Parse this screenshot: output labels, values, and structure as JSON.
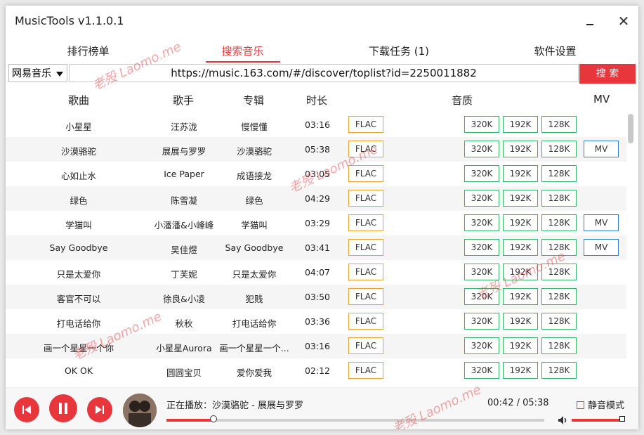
{
  "app": {
    "title": "MusicTools v1.1.0.1"
  },
  "tabs": [
    {
      "label": "排行榜单"
    },
    {
      "label": "搜索音乐"
    },
    {
      "label": "下载任务 (1)"
    },
    {
      "label": "软件设置"
    }
  ],
  "search": {
    "source": "网易音乐",
    "url": "https://music.163.com/#/discover/toplist?id=2250011882",
    "button": "搜 索"
  },
  "columns": {
    "song": "歌曲",
    "artist": "歌手",
    "album": "专辑",
    "duration": "时长",
    "quality": "音质",
    "mv": "MV"
  },
  "quality_labels": {
    "flac": "FLAC",
    "q320": "320K",
    "q192": "192K",
    "q128": "128K",
    "mv": "MV"
  },
  "songs": [
    {
      "song": "小星星",
      "artist": "汪苏泷",
      "album": "慢慢懂",
      "duration": "03:16",
      "mv": false
    },
    {
      "song": "沙漠骆驼",
      "artist": "展展与罗罗",
      "album": "沙漠骆驼",
      "duration": "05:38",
      "mv": true
    },
    {
      "song": "心如止水",
      "artist": "Ice Paper",
      "album": "成语接龙",
      "duration": "03:05",
      "mv": false
    },
    {
      "song": "绿色",
      "artist": "陈雪凝",
      "album": "绿色",
      "duration": "04:29",
      "mv": false
    },
    {
      "song": "学猫叫",
      "artist": "小潘潘&小峰峰",
      "album": "学猫叫",
      "duration": "03:29",
      "mv": true
    },
    {
      "song": "Say Goodbye",
      "artist": "吴佳煜",
      "album": "Say Goodbye",
      "duration": "03:41",
      "mv": true
    },
    {
      "song": "只是太爱你",
      "artist": "丁芙妮",
      "album": "只是太爱你",
      "duration": "04:07",
      "mv": false
    },
    {
      "song": "客官不可以",
      "artist": "徐良&小凌",
      "album": "犯贱",
      "duration": "03:50",
      "mv": false
    },
    {
      "song": "打电话给你",
      "artist": "秋秋",
      "album": "打电话给你",
      "duration": "03:36",
      "mv": false
    },
    {
      "song": "画一个星星一个你",
      "artist": "小星星Aurora",
      "album": "画一个星星一个...",
      "duration": "03:16",
      "mv": false
    },
    {
      "song": "OK OK",
      "artist": "圆圆宝贝",
      "album": "爱你爱我",
      "duration": "02:12",
      "mv": false
    }
  ],
  "player": {
    "now_playing": "正在播放：沙漠骆驼 - 展展与罗罗",
    "time": "00:42 / 05:38",
    "progress": 0.124,
    "volume": 1.0,
    "mute_label": "静音模式",
    "mute_checked": false
  },
  "watermark": "老殁 Laomo.me",
  "colors": {
    "accent": "#e8373c",
    "flac": "#f0a030",
    "quality": "#36b36b",
    "mv": "#2a7ed3"
  }
}
